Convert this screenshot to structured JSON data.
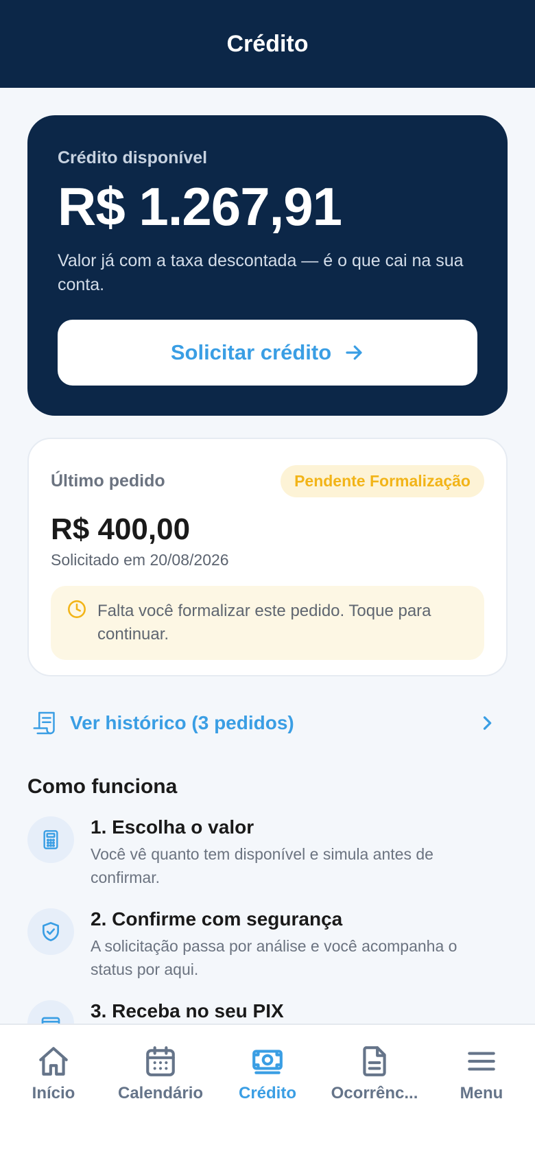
{
  "header": {
    "title": "Crédito"
  },
  "hero": {
    "label": "Crédito disponível",
    "amount": "R$ 1.267,91",
    "note": "Valor já com a taxa descontada — é o que cai na sua conta.",
    "button_label": "Solicitar crédito",
    "button_icon": "arrow-right-icon"
  },
  "last_order": {
    "label": "Último pedido",
    "status": "Pendente Formalização",
    "amount": "R$ 400,00",
    "date": "Solicitado em 20/08/2026",
    "alert": "Falta você formalizar este pedido. Toque para continuar.",
    "alert_icon": "clock-icon"
  },
  "history": {
    "label": "Ver histórico (3 pedidos)",
    "icon": "receipt-icon"
  },
  "how_it_works": {
    "title": "Como funciona",
    "steps": [
      {
        "title": "1. Escolha o valor",
        "desc": "Você vê quanto tem disponível e simula antes de confirmar.",
        "icon": "calculator-icon"
      },
      {
        "title": "2. Confirme com segurança",
        "desc": "A solicitação passa por análise e você acompanha o status por aqui.",
        "icon": "shield-check-icon"
      },
      {
        "title": "3. Receba no seu PIX",
        "desc": "",
        "icon": "card-icon"
      }
    ]
  },
  "tabbar": {
    "items": [
      {
        "label": "Início",
        "icon": "home-icon"
      },
      {
        "label": "Calendário",
        "icon": "calendar-icon"
      },
      {
        "label": "Crédito",
        "icon": "money-icon",
        "active": true
      },
      {
        "label": "Ocorrênc...",
        "icon": "document-icon"
      },
      {
        "label": "Menu",
        "icon": "menu-icon"
      }
    ]
  },
  "colors": {
    "navy": "#0c2748",
    "accent": "#3a9ee4",
    "pending": "#f2b418",
    "background": "#f4f7fb"
  }
}
